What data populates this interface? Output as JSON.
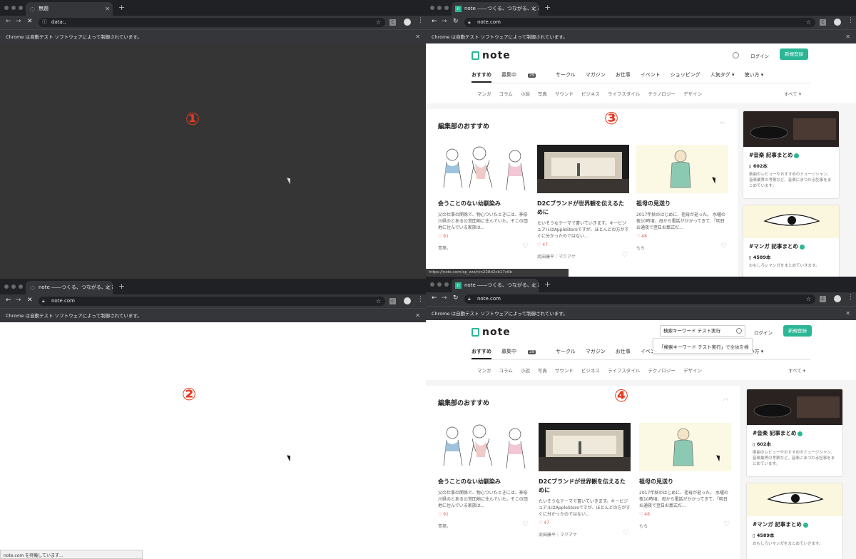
{
  "win1": {
    "tab_title": "無題",
    "url": "data:,",
    "infobar": "Chrome は自動テスト ソフトウェアによって制御されています。",
    "marker": "①"
  },
  "win2": {
    "tab_title": "note ――つくる、つながる、とど",
    "url": "note.com",
    "infobar": "Chrome は自動テスト ソフトウェアによって制御されています。",
    "marker": "②",
    "status": "note.com を待機しています..."
  },
  "win3": {
    "tab_title": "note ――つくる、つながる、とど",
    "url": "note.com",
    "infobar": "Chrome は自動テスト ソフトウェアによって制御されています。",
    "marker": "③",
    "link_status": "https://note.com/sp_zzz/n/n228d2cb17c6b"
  },
  "win4": {
    "tab_title": "note ――つくる、つながる、とど",
    "url": "note.com",
    "infobar": "Chrome は自動テスト ソフトウェアによって制御されています。",
    "marker": "④",
    "search_value": "検索キーワード テスト実行",
    "dropdown_term": "「検索キーワード テスト実行」",
    "dropdown_suffix": "で全体を検"
  },
  "note": {
    "logo": "note",
    "login": "ログイン",
    "signup": "新規登録",
    "main_tabs": [
      "おすすめ",
      "募集中",
      "サークル",
      "マガジン",
      "お仕事",
      "イベント",
      "ショッピング",
      "人気タグ ▾",
      "使い方 ▾"
    ],
    "recruit_count": "29",
    "sub_tabs": [
      "マンガ",
      "コラム",
      "小説",
      "写真",
      "サウンド",
      "ビジネス",
      "ライフスタイル",
      "テクノロジー",
      "デザイン"
    ],
    "sub_all": "すべて ▾",
    "section_title": "編集部のおすすめ",
    "cards": [
      {
        "title": "会うことのない幼馴染み",
        "desc": "父の仕事の関係で、物心ついたときには、神奈川県のとある公営団地に住んでいた。そこの団地に住んでいる家族は...",
        "likes": "♡ 91",
        "author": "青葉。"
      },
      {
        "title": "D2Cブランドが世界観を伝えるために",
        "desc": "たいそうなテーマで書いていきます。キービジュアルはAppleStoreですが、ほとんどの方がすぐに分かったのではない...",
        "likes": "♡ 47",
        "author": "武田康平｜マクアケ"
      },
      {
        "title": "祖母の見送り",
        "desc": "2017年秋のはじめに、祖母が逝った。 水曜の夜10時頃、母から電話がかかってきて、「明日お通夜で翌日お葬式だ...",
        "likes": "♡ 48",
        "author": "もち"
      }
    ],
    "side": [
      {
        "title": "#音楽 記事まとめ",
        "count": "602本",
        "desc": "楽曲のレビューやおすすめのミュージシャン、音楽業界の考察など、音楽にまつわる記事をまとめています。"
      },
      {
        "title": "#マンガ 記事まとめ",
        "count": "4589本",
        "desc": "おもしろいマンガをまとめていきます。"
      }
    ]
  },
  "colors": {
    "accent": "#2cb696",
    "marker": "#e63a1f",
    "chrome_dark": "#35363a"
  }
}
